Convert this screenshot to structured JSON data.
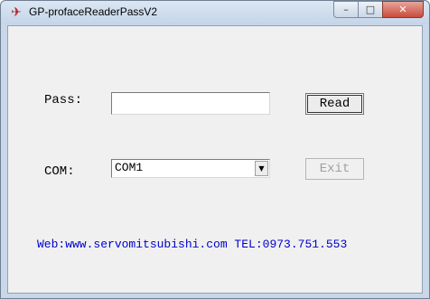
{
  "window": {
    "title": "GP-profaceReaderPassV2",
    "icon": "proface-logo-icon",
    "controls": {
      "minimize": "–",
      "maximize": "□",
      "close": "✕"
    }
  },
  "form": {
    "pass_label": "Pass:",
    "pass_value": "",
    "read_button": "Read",
    "com_label": "COM:",
    "com_selected": "COM1",
    "exit_button": "Exit",
    "footer": "Web:www.servomitsubishi.com TEL:0973.751.553"
  },
  "colors": {
    "footer_text": "#0000cc",
    "disabled_text": "#a0a0a0"
  }
}
